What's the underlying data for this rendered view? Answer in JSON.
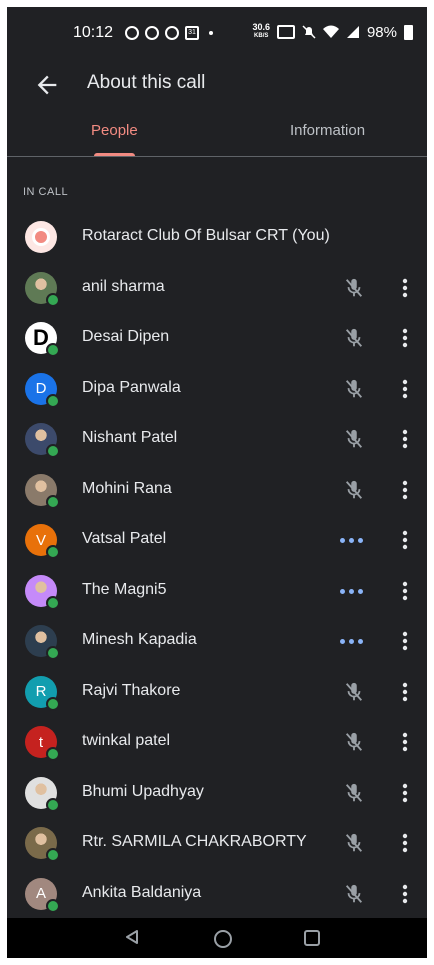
{
  "status_bar": {
    "time": "10:12",
    "speed_top": "30.6",
    "speed_bottom": "KB/S",
    "battery": "98%"
  },
  "header": {
    "title": "About this call",
    "back_icon": "arrow-back-icon"
  },
  "tabs": [
    {
      "label": "People",
      "active": true
    },
    {
      "label": "Information",
      "active": false
    }
  ],
  "section_label": "IN CALL",
  "participants": [
    {
      "name": "Rotaract Club Of Bulsar CRT (You)",
      "avatar": "logo",
      "color": "#f28b82",
      "status": "none"
    },
    {
      "name": "anil sharma",
      "avatar": "photo",
      "color": "#5f7a55",
      "status": "muted"
    },
    {
      "name": "Desai Dipen",
      "avatar": "letter-logo",
      "initial": "D",
      "color": "#ffffff",
      "status": "muted"
    },
    {
      "name": "Dipa Panwala",
      "avatar": "initial",
      "initial": "D",
      "color": "#1a73e8",
      "status": "muted"
    },
    {
      "name": "Nishant Patel",
      "avatar": "photo",
      "color": "#3c4a6b",
      "status": "muted"
    },
    {
      "name": "Mohini Rana",
      "avatar": "photo",
      "color": "#8a7a6a",
      "status": "muted"
    },
    {
      "name": "Vatsal Patel",
      "avatar": "initial",
      "initial": "V",
      "color": "#e8710a",
      "status": "speaking"
    },
    {
      "name": "The Magni5",
      "avatar": "photo",
      "color": "#c58af9",
      "status": "speaking"
    },
    {
      "name": "Minesh Kapadia",
      "avatar": "photo",
      "color": "#2d3e4f",
      "status": "speaking"
    },
    {
      "name": "Rajvi Thakore",
      "avatar": "initial",
      "initial": "R",
      "color": "#129eaf",
      "status": "muted"
    },
    {
      "name": "twinkal patel",
      "avatar": "initial",
      "initial": "t",
      "color": "#c5221f",
      "status": "muted"
    },
    {
      "name": "Bhumi Upadhyay",
      "avatar": "photo",
      "color": "#e0e0e0",
      "status": "muted"
    },
    {
      "name": "Rtr. SARMILA CHAKRABORTY",
      "avatar": "photo",
      "color": "#7a6a4a",
      "status": "muted"
    },
    {
      "name": "Ankita Baldaniya",
      "avatar": "initial",
      "initial": "A",
      "color": "#a1887f",
      "status": "muted"
    }
  ],
  "nav": {
    "back_icon": "nav-back-icon",
    "home_icon": "nav-home-icon",
    "recents_icon": "nav-recents-icon"
  }
}
